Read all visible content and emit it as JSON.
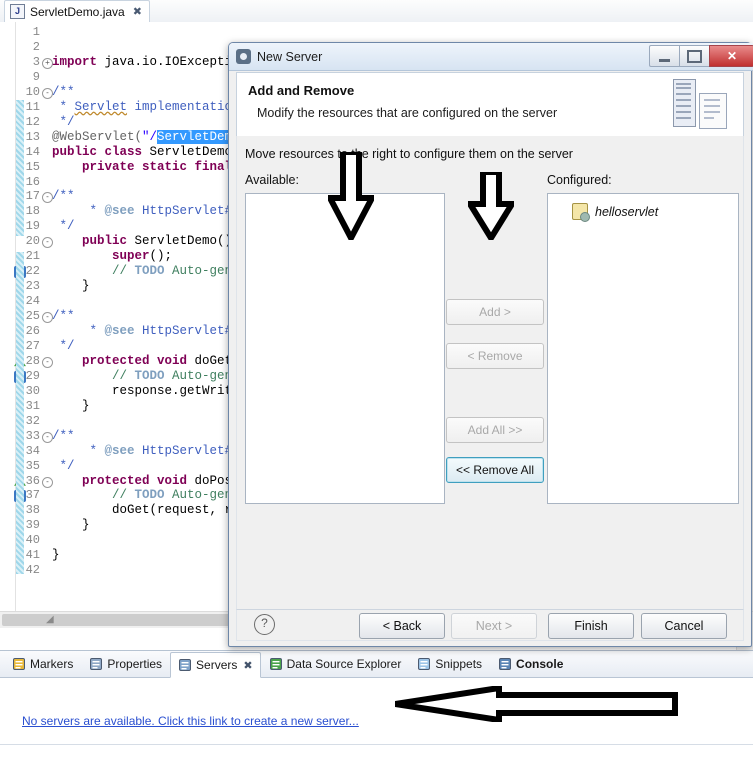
{
  "editor": {
    "tab": {
      "filename": "ServletDemo.java",
      "icon": "java-file-icon",
      "close": "✖"
    },
    "lines": [
      {
        "n": "1",
        "indent": 0,
        "html": ""
      },
      {
        "n": "2",
        "indent": 0,
        "html": ""
      },
      {
        "n": "3",
        "fold": "+",
        "html": "import-java-io-IOException"
      },
      {
        "n": "9",
        "html": ""
      },
      {
        "n": "10",
        "fold": "-",
        "html": "javadoc-open"
      },
      {
        "n": "11",
        "html": "servlet-implementation"
      },
      {
        "n": "12",
        "html": "javadoc-close"
      },
      {
        "n": "13",
        "html": "webservlet-annotation"
      },
      {
        "n": "14",
        "html": "public-class"
      },
      {
        "n": "15",
        "html": "private-static-final"
      },
      {
        "n": "16",
        "html": ""
      },
      {
        "n": "17",
        "fold": "-",
        "html": "javadoc-open"
      },
      {
        "n": "18",
        "html": "see-httpservlet"
      },
      {
        "n": "19",
        "html": "javadoc-close"
      },
      {
        "n": "20",
        "fold": "-",
        "html": "ctor"
      },
      {
        "n": "21",
        "html": "super"
      },
      {
        "n": "22",
        "html": "todo"
      },
      {
        "n": "23",
        "html": "brace"
      },
      {
        "n": "24",
        "html": ""
      },
      {
        "n": "25",
        "fold": "-",
        "html": "javadoc-open"
      },
      {
        "n": "26",
        "html": "see-httpservlet"
      },
      {
        "n": "27",
        "html": "javadoc-close"
      },
      {
        "n": "28",
        "fold": "-",
        "html": "doget"
      },
      {
        "n": "29",
        "html": "todo"
      },
      {
        "n": "30",
        "html": "response-getwriter"
      },
      {
        "n": "31",
        "html": "brace"
      },
      {
        "n": "32",
        "html": ""
      },
      {
        "n": "33",
        "fold": "-",
        "html": "javadoc-open"
      },
      {
        "n": "34",
        "html": "see-httpservlet"
      },
      {
        "n": "35",
        "html": "javadoc-close"
      },
      {
        "n": "36",
        "fold": "-",
        "html": "dopost"
      },
      {
        "n": "37",
        "html": "todo"
      },
      {
        "n": "38",
        "html": "doget-call"
      },
      {
        "n": "39",
        "html": "brace"
      },
      {
        "n": "40",
        "html": ""
      },
      {
        "n": "41",
        "html": "class-close"
      },
      {
        "n": "42",
        "html": ""
      }
    ],
    "code_text": {
      "import": "import java.io.IOExceptio",
      "javadoc_open": "/**",
      "javadoc_close": " */",
      "servlet_impl": " * Servlet implementation",
      "webservlet": "@WebServlet(\"/",
      "webservlet_sel": "ServletDemo",
      "public_class": "public class ServletDemo",
      "private_static_final": "    private static final",
      "see_httpservlet": "     * @see HttpServlet#d",
      "see_httpservlet_h": "     * @see HttpServlet#H",
      "ctor": "    public ServletDemo()",
      "super": "        super();",
      "todo": "        // TODO Auto-gene",
      "brace_close": "    }",
      "doget": "    protected void doGet(",
      "dopost": "    protected void doPost",
      "response_getwriter": "        response.getWrite",
      "doget_call": "        doGet(request, re",
      "class_close": "}"
    }
  },
  "dialog": {
    "title": "New Server",
    "title_icon": "server-gear-icon",
    "window_buttons": {
      "minimize": "minimize-icon",
      "maximize": "maximize-icon",
      "close": "✕"
    },
    "header": {
      "title": "Add and Remove",
      "subtitle": "Modify the resources that are configured on the server",
      "icon": "server-and-document-icon"
    },
    "instruction": "Move resources to the right to configure them on the server",
    "available_label": "Available:",
    "configured_label": "Configured:",
    "available_items": [],
    "configured_items": [
      {
        "label": "helloservlet",
        "icon": "web-module-icon"
      }
    ],
    "mid_buttons": [
      {
        "label": "Add >",
        "name": "add-button",
        "enabled": false
      },
      {
        "label": "< Remove",
        "name": "remove-button",
        "enabled": false
      },
      {
        "label": "Add All >>",
        "name": "add-all-button",
        "enabled": false
      },
      {
        "label": "<< Remove All",
        "name": "remove-all-button",
        "enabled": true
      }
    ],
    "footer": {
      "help": "?",
      "back": "< Back",
      "next": "Next >",
      "finish": "Finish",
      "cancel": "Cancel"
    }
  },
  "bottom_panel": {
    "tabs": [
      {
        "label": "Markers",
        "icon": "markers-icon",
        "active": false,
        "bold": false
      },
      {
        "label": "Properties",
        "icon": "properties-icon",
        "active": false,
        "bold": false
      },
      {
        "label": "Servers",
        "icon": "servers-icon",
        "active": true,
        "bold": false,
        "close": "✖"
      },
      {
        "label": "Data Source Explorer",
        "icon": "data-source-icon",
        "active": false,
        "bold": false
      },
      {
        "label": "Snippets",
        "icon": "snippets-icon",
        "active": false,
        "bold": false
      },
      {
        "label": "Console",
        "icon": "console-icon",
        "active": false,
        "bold": true
      }
    ],
    "servers_link": "No servers are available. Click this link to create a new server..."
  },
  "annotations": {
    "arrow_left_label": "down-arrow-available-list",
    "arrow_right_label": "down-arrow-add-button",
    "arrow_bottom_label": "left-arrow-new-server-link"
  },
  "colors": {
    "keyword": "#7f0055",
    "comment": "#3f7f5f",
    "javadoc": "#3f5fbf",
    "string": "#2a00ff",
    "selection": "#3399ff",
    "link": "#2a4fd0",
    "close_button": "#c03030"
  }
}
